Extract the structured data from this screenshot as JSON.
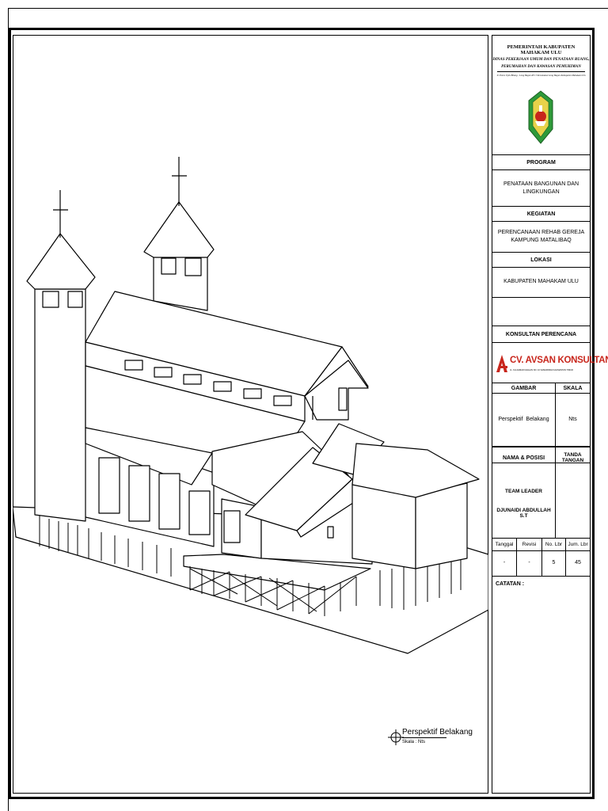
{
  "title_block": {
    "agency": {
      "government": "PEMERINTAH KABUPATEN MAHAKAM ULU",
      "department_line1": "DINAS PEKERJAAN UMUM DAN PENATAAN RUANG,",
      "department_line2": "PERUMAHAN DAN KAWASAN PEMUKIMAN",
      "address": "Jl. Poros Ujoh Bilang - Long Bagun RT. 3 Kecamatan Long Bagun Kabupaten Mahakam Ulu"
    },
    "program": {
      "label": "PROGRAM",
      "value": "PENATAAN BANGUNAN DAN LINGKUNGAN"
    },
    "kegiatan": {
      "label": "KEGIATAN",
      "value": "PERENCANAAN REHAB GEREJA KAMPUNG MATALIBAQ"
    },
    "lokasi": {
      "label": "LOKASI",
      "value": "KABUPATEN MAHAKAM ULU"
    },
    "konsultan": {
      "label": "KONSULTAN PERENCANA",
      "logo_text": "CV. AVSAN KONSULTAN",
      "logo_subtext": "JL. KH AHMAD DAHLAN NO. 10 SAMARINDA KALIMANTAN TIMUR"
    },
    "gambar": {
      "label": "GAMBAR",
      "value": "Perspektif  Belakang"
    },
    "skala": {
      "label": "SKALA",
      "value": "Nts"
    },
    "nama_posisi": {
      "label": "NAMA & POSISI",
      "role": "TEAM LEADER",
      "name": "DJUNAIDI ABDULLAH S.T"
    },
    "tanda_tangan": {
      "label": "TANDA TANGAN"
    },
    "meta": {
      "tanggal": {
        "label": "Tanggal",
        "value": "-"
      },
      "revisi": {
        "label": "Revisi",
        "value": "-"
      },
      "no_lbr": {
        "label": "No. Lbr",
        "value": "5"
      },
      "jum_lbr": {
        "label": "Jum. Lbr",
        "value": "45"
      }
    },
    "catatan": {
      "label": "CATATAN :"
    }
  },
  "drawing": {
    "caption": "Perspektif Belakang",
    "scale_text": "Skala : Nts"
  },
  "colors": {
    "emblem_green": "#2e9a3a",
    "consultant_red": "#c8261c"
  }
}
